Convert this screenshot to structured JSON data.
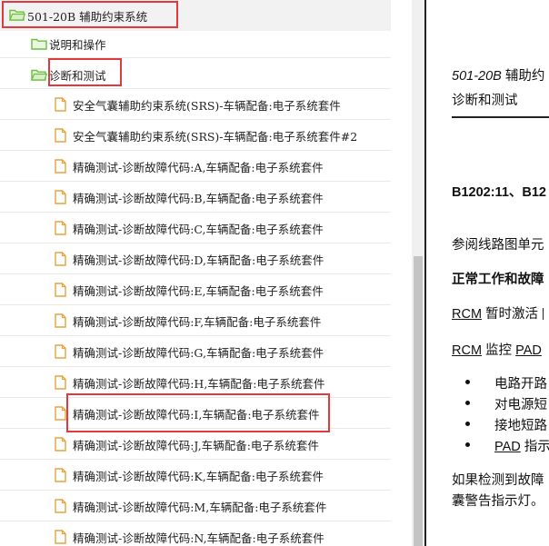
{
  "tree": {
    "root": {
      "label": "501-20B 辅助约束系统"
    },
    "folders": [
      {
        "label": "说明和操作"
      },
      {
        "label": "诊断和测试"
      }
    ],
    "docs": [
      {
        "label": "安全气囊辅助约束系统(SRS)-车辆配备:电子系统套件"
      },
      {
        "label": "安全气囊辅助约束系统(SRS)-车辆配备:电子系统套件#2"
      },
      {
        "label": "精确测试-诊断故障代码:A,车辆配备:电子系统套件"
      },
      {
        "label": "精确测试-诊断故障代码:B,车辆配备:电子系统套件"
      },
      {
        "label": "精确测试-诊断故障代码:C,车辆配备:电子系统套件"
      },
      {
        "label": "精确测试-诊断故障代码:D,车辆配备:电子系统套件"
      },
      {
        "label": "精确测试-诊断故障代码:E,车辆配备:电子系统套件"
      },
      {
        "label": "精确测试-诊断故障代码:F,车辆配备:电子系统套件"
      },
      {
        "label": "精确测试-诊断故障代码:G,车辆配备:电子系统套件"
      },
      {
        "label": "精确测试-诊断故障代码:H,车辆配备:电子系统套件"
      },
      {
        "label": "精确测试-诊断故障代码:I,车辆配备:电子系统套件"
      },
      {
        "label": "精确测试-诊断故障代码:J,车辆配备:电子系统套件"
      },
      {
        "label": "精确测试-诊断故障代码:K,车辆配备:电子系统套件"
      },
      {
        "label": "精确测试-诊断故障代码:M,车辆配备:电子系统套件"
      },
      {
        "label": "精确测试-诊断故障代码:N,车辆配备:电子系统套件"
      }
    ]
  },
  "document": {
    "header_model": "501-20B",
    "header_title": "辅助约",
    "header_subtitle": "诊断和测试",
    "dtc": "B1202:11、B12",
    "ref": "参阅线路图单元",
    "section": "正常工作和故障",
    "p1_link": "RCM",
    "p1_text": " 暂时激活 ",
    "p2_link": "RCM",
    "p2_text": " 监控 ",
    "p2_link2": "PAD",
    "bullets": [
      "电路开路",
      "对电源短",
      "接地短路",
      "指示"
    ],
    "bullet4_link": "PAD",
    "p3_line1": "如果检测到故障",
    "p3_line2": "囊警告指示灯。"
  },
  "colors": {
    "highlight": "#e0393e",
    "folder_icon": "#6cbf3f",
    "doc_icon": "#e8a23c",
    "selected_row": "#f2f2f2"
  }
}
